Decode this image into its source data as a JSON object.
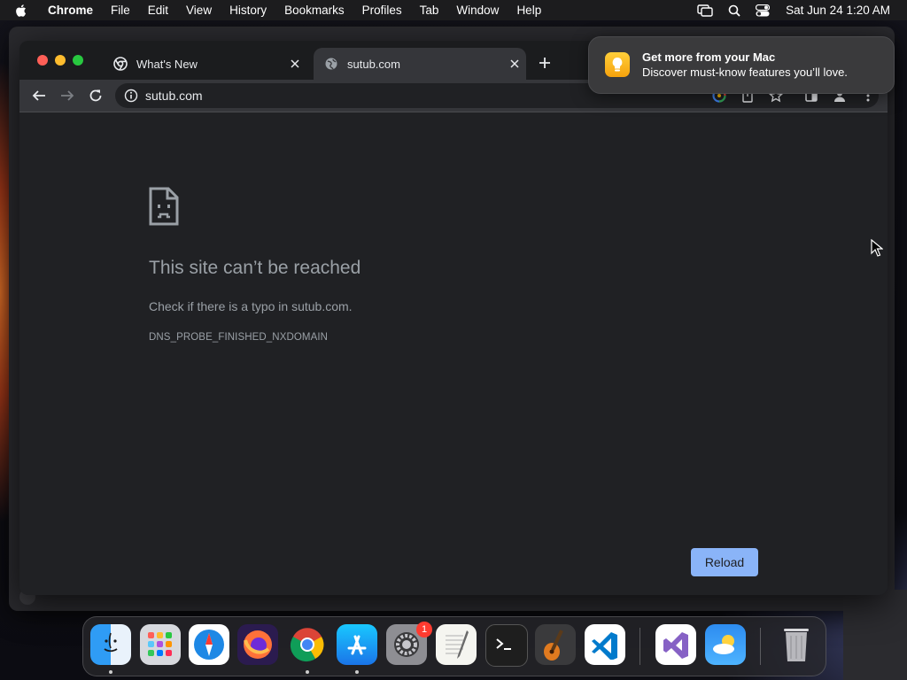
{
  "menubar": {
    "app_name": "Chrome",
    "items": [
      "File",
      "Edit",
      "View",
      "History",
      "Bookmarks",
      "Profiles",
      "Tab",
      "Window",
      "Help"
    ],
    "clock": "Sat Jun 24  1:20 AM"
  },
  "browser": {
    "tabs": [
      {
        "title": "What's New",
        "favicon": "chrome-logo-icon",
        "active": false
      },
      {
        "title": "sutub.com",
        "favicon": "globe-icon",
        "active": true
      }
    ],
    "omnibox": {
      "url": "sutub.com"
    }
  },
  "error_page": {
    "title": "This site can’t be reached",
    "detail": "Check if there is a typo in sutub.com.",
    "code": "DNS_PROBE_FINISHED_NXDOMAIN",
    "reload_label": "Reload"
  },
  "notification": {
    "title": "Get more from your Mac",
    "body": "Discover must-know features you’ll love."
  },
  "dock": {
    "apps": [
      "finder-icon",
      "launchpad-icon",
      "safari-icon",
      "firefox-icon",
      "chrome-icon",
      "app-store-icon",
      "system-settings-icon",
      "textedit-icon",
      "terminal-icon",
      "garageband-icon",
      "vscode-icon",
      "visual-studio-icon",
      "weather-icon",
      "trash-icon"
    ],
    "system_settings_badge": "1"
  },
  "colors": {
    "page_bg": "#202124",
    "toolbar_bg": "#35363a",
    "reload_button": "#8ab4f8",
    "error_text": "#9aa0a6"
  }
}
